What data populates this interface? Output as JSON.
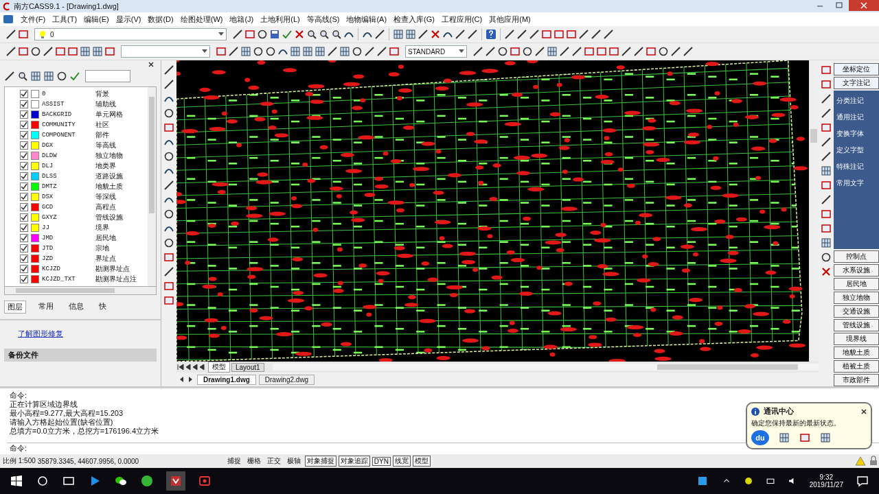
{
  "window": {
    "title": "南方CASS9.1 - [Drawing1.dwg]"
  },
  "menu": [
    "文件(F)",
    "工具(T)",
    "编辑(E)",
    "显示(V)",
    "数据(D)",
    "绘图处理(W)",
    "地籍(J)",
    "土地利用(L)",
    "等高线(S)",
    "地物编辑(A)",
    "检查入库(G)",
    "工程应用(C)",
    "其他应用(M)"
  ],
  "toolbar": {
    "layer_value": "0",
    "style_value": "STANDARD"
  },
  "layers": [
    {
      "name": "0",
      "desc": "背景",
      "color": "#ffffff",
      "checked": true
    },
    {
      "name": "ASSIST",
      "desc": "辅助线",
      "color": "#ffffff",
      "checked": true
    },
    {
      "name": "BACKGRID",
      "desc": "单元网格",
      "color": "#0000cc",
      "checked": true
    },
    {
      "name": "COMMUNITY",
      "desc": "社区",
      "color": "#ff0000",
      "checked": true
    },
    {
      "name": "COMPONENT",
      "desc": "部件",
      "color": "#00ffff",
      "checked": true
    },
    {
      "name": "DGX",
      "desc": "等高线",
      "color": "#ffff00",
      "checked": true
    },
    {
      "name": "DLDW",
      "desc": "独立地物",
      "color": "#ff88cc",
      "checked": true
    },
    {
      "name": "DLJ",
      "desc": "地类界",
      "color": "#ffff00",
      "checked": true
    },
    {
      "name": "DLSS",
      "desc": "道路设施",
      "color": "#00ccff",
      "checked": true
    },
    {
      "name": "DMTZ",
      "desc": "地貌土质",
      "color": "#00ff00",
      "checked": true
    },
    {
      "name": "DSX",
      "desc": "等深线",
      "color": "#ffff00",
      "checked": true
    },
    {
      "name": "GCD",
      "desc": "高程点",
      "color": "#ff0000",
      "checked": true
    },
    {
      "name": "GXYZ",
      "desc": "管线设施",
      "color": "#ffff00",
      "checked": true
    },
    {
      "name": "JJ",
      "desc": "境界",
      "color": "#ffff00",
      "checked": true
    },
    {
      "name": "JMD",
      "desc": "居民地",
      "color": "#ff00ff",
      "checked": true
    },
    {
      "name": "JTD",
      "desc": "宗地",
      "color": "#ff0000",
      "checked": true
    },
    {
      "name": "JZD",
      "desc": "界址点",
      "color": "#ff0000",
      "checked": true
    },
    {
      "name": "KCJZD",
      "desc": "勘测界址点",
      "color": "#ff0000",
      "checked": true
    },
    {
      "name": "KCJZD_TXT",
      "desc": "勘测界址点注",
      "color": "#ff0000",
      "checked": true
    }
  ],
  "panel_tabs": [
    {
      "label": "图层",
      "selected": true
    },
    {
      "label": "常用",
      "selected": false
    },
    {
      "label": "信息",
      "selected": false
    },
    {
      "label": "快",
      "selected": false
    }
  ],
  "recovery": {
    "link": "了解图形修复",
    "section": "备份文件"
  },
  "layout_tabs": [
    {
      "label": "模型",
      "selected": true
    },
    {
      "label": "Layout1",
      "selected": false
    }
  ],
  "file_tabs": [
    {
      "label": "Drawing1.dwg",
      "selected": true
    },
    {
      "label": "Drawing2.dwg",
      "selected": false
    }
  ],
  "right_panel": {
    "top_buttons": [
      "坐标定位",
      "文字注记"
    ],
    "annotation_items": [
      "分类注记",
      "通用注记",
      "变换字体",
      "定义字型",
      "特殊注记",
      "常用文字"
    ],
    "categories": [
      "控制点",
      "水系设施",
      "居民地",
      "独立地物",
      "交通设施",
      "管线设施",
      "境界线",
      "地貌土质",
      "植被土质",
      "市政部件"
    ]
  },
  "command": {
    "lines": [
      "命令:",
      "正在计算区域边界线",
      "最小高程=9.277,最大高程=15.203",
      "请输入方格起始位置(缺省位置)",
      "总填方=0.0立方米，总挖方=176196.4立方米"
    ],
    "prompt": "命令:"
  },
  "status_bar": {
    "scale": "比例 1:500",
    "coords": "35879.3345, 44607.9956, 0.0000",
    "toggles": [
      {
        "label": "捕捉",
        "on": false
      },
      {
        "label": "栅格",
        "on": false
      },
      {
        "label": "正交",
        "on": false
      },
      {
        "label": "极轴",
        "on": false
      },
      {
        "label": "对象捕捉",
        "on": true
      },
      {
        "label": "对象追踪",
        "on": true
      },
      {
        "label": "DYN",
        "on": true
      },
      {
        "label": "线宽",
        "on": true
      },
      {
        "label": "模型",
        "on": true
      }
    ]
  },
  "notification": {
    "title": "通讯中心",
    "message": "确定您保持最新的最新状态。",
    "logo": "du"
  },
  "taskbar": {
    "time": "9:32",
    "date": "2019/11/27"
  }
}
